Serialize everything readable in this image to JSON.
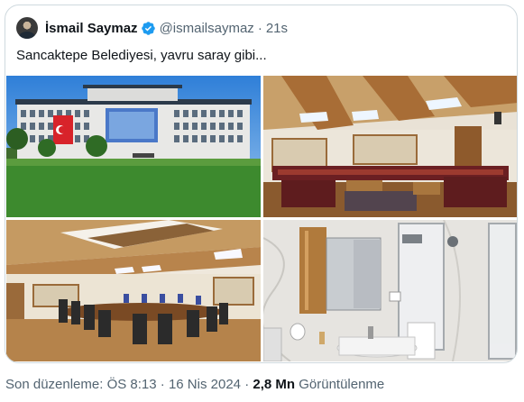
{
  "tweet": {
    "author_name": "İsmail Saymaz",
    "handle": "@ismailsaymaz",
    "separator": "·",
    "time": "21s",
    "text": "Sancaktepe Belediyesi, yavru saray gibi...",
    "verified_color": "#1d9bf0",
    "images": [
      {
        "icon": "photo-municipal-building-exterior"
      },
      {
        "icon": "photo-lounge-room-with-sofas"
      },
      {
        "icon": "photo-meeting-room-with-table"
      },
      {
        "icon": "photo-bathroom-with-shower"
      }
    ]
  },
  "footer": {
    "edited_prefix": "Son düzenleme: ÖS 8:13",
    "separator": "·",
    "date": "16 Nis 2024",
    "views_count": "2,8 Mn",
    "views_label": "Görüntülenme"
  }
}
